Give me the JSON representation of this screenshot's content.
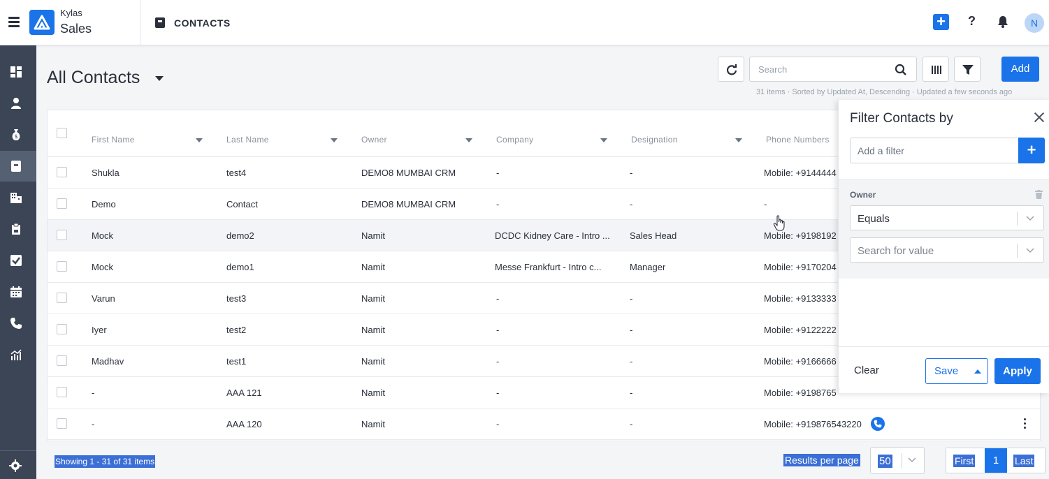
{
  "app": {
    "brand_top": "Kylas",
    "brand_bottom": "Sales",
    "module_title": "CONTACTS",
    "avatar_initial": "N"
  },
  "icons": [
    "menu-icon",
    "quick-add-icon",
    "help-icon",
    "bell-icon",
    "dashboard-icon",
    "user-icon",
    "money-bag-icon",
    "contact-card-icon",
    "building-icon",
    "clipboard-icon",
    "checkbox-icon",
    "calendar-icon",
    "phone-icon",
    "reports-icon",
    "settings-icon",
    "refresh-icon",
    "search-icon",
    "columns-icon",
    "filter-icon"
  ],
  "colors": {
    "accent": "#1a73e8",
    "sidebar": "#3c4555",
    "sidebar_active": "#566073"
  },
  "view": {
    "title": "All Contacts"
  },
  "toolbar": {
    "search_placeholder": "Search",
    "add_label": "Add",
    "meta": "31 items · Sorted by Updated At, Descending · Updated a few seconds ago"
  },
  "table": {
    "columns": [
      "First Name",
      "Last Name",
      "Owner",
      "Company",
      "Designation",
      "Phone Numbers"
    ],
    "rows": [
      {
        "first": "Shukla",
        "last": "test4",
        "owner": "DEMO8 MUMBAI CRM",
        "company": "-",
        "designation": "-",
        "phone": "Mobile: +9144444"
      },
      {
        "first": "Demo",
        "last": "Contact",
        "owner": "DEMO8 MUMBAI CRM",
        "company": "-",
        "designation": "-",
        "phone": "-"
      },
      {
        "first": "Mock",
        "last": "demo2",
        "owner": "Namit",
        "company": "DCDC Kidney Care - Intro ...",
        "designation": "Sales Head",
        "phone": "Mobile: +9198192"
      },
      {
        "first": "Mock",
        "last": "demo1",
        "owner": "Namit",
        "company": "Messe Frankfurt - Intro c...",
        "designation": "Manager",
        "phone": "Mobile: +9170204"
      },
      {
        "first": "Varun",
        "last": "test3",
        "owner": "Namit",
        "company": "-",
        "designation": "-",
        "phone": "Mobile: +9133333"
      },
      {
        "first": "Iyer",
        "last": "test2",
        "owner": "Namit",
        "company": "-",
        "designation": "-",
        "phone": "Mobile: +9122222"
      },
      {
        "first": "Madhav",
        "last": "test1",
        "owner": "Namit",
        "company": "-",
        "designation": "-",
        "phone": "Mobile: +9166666"
      },
      {
        "first": "-",
        "last": "AAA 121",
        "owner": "Namit",
        "company": "-",
        "designation": "-",
        "phone": "Mobile: +9198765"
      },
      {
        "first": "-",
        "last": "AAA 120",
        "owner": "Namit",
        "company": "-",
        "designation": "-",
        "phone": "Mobile: +919876543220"
      }
    ]
  },
  "footer": {
    "showing": "Showing 1 - 31 of 31 items",
    "rpp_label": "Results per page",
    "rpp_value": "50",
    "first": "First",
    "current_page": "1",
    "last": "Last"
  },
  "filter_panel": {
    "title": "Filter Contacts by",
    "add_placeholder": "Add a filter",
    "field_label": "Owner",
    "operator": "Equals",
    "value_placeholder": "Search for value",
    "clear": "Clear",
    "save": "Save",
    "apply": "Apply"
  }
}
